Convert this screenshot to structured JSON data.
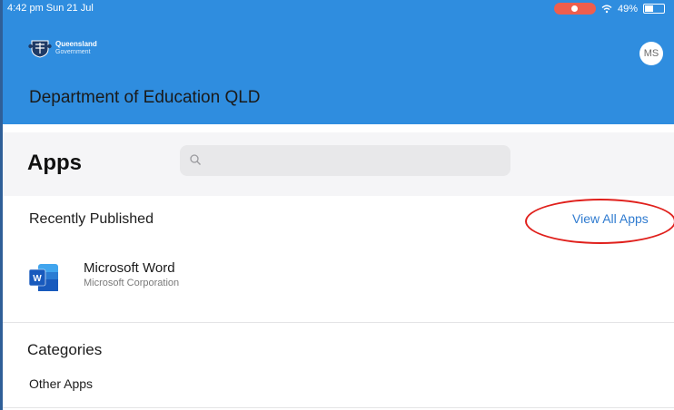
{
  "status_bar": {
    "time_date": "4:42 pm  Sun 21 Jul",
    "battery": "49%",
    "icons": [
      "screen-recording-icon",
      "wifi-icon",
      "battery-icon"
    ]
  },
  "header": {
    "logo": {
      "line1": "Queensland",
      "line2": "Government"
    },
    "avatar_initials": "MS",
    "organization": "Department of Education QLD"
  },
  "apps_section": {
    "title": "Apps",
    "search_placeholder": ""
  },
  "recently_published": {
    "title": "Recently Published",
    "view_all_label": "View All Apps",
    "apps": [
      {
        "name": "Microsoft Word",
        "vendor": "Microsoft Corporation",
        "icon": "microsoft-word-icon"
      }
    ]
  },
  "categories": {
    "title": "Categories",
    "items": [
      {
        "label": "Other Apps"
      }
    ]
  },
  "colors": {
    "header_blue": "#2f8ddf",
    "link_blue": "#2f7bd0",
    "annotation_red": "#e0201c"
  }
}
